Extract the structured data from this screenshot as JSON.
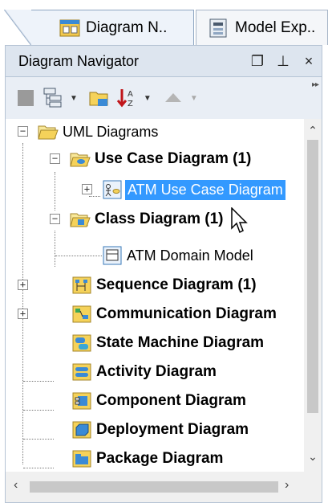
{
  "tabs": [
    {
      "label": "Diagram N..",
      "icon": "diagram-navigator-icon",
      "active": true
    },
    {
      "label": "Model Exp..",
      "icon": "model-explorer-icon",
      "active": false
    }
  ],
  "panel": {
    "title": "Diagram Navigator",
    "buttons": {
      "restore": "❐",
      "pin": "⊥",
      "close": "×"
    }
  },
  "toolbar": {
    "icons": [
      "new-diagram-icon",
      "tree-layout-icon",
      "folder-view-icon",
      "sort-icon",
      "navigate-up-icon"
    ]
  },
  "tree": {
    "root": {
      "label": "UML Diagrams",
      "expanded": true
    },
    "categories": [
      {
        "label": "Use Case Diagram (1)",
        "expanded": true,
        "children": [
          {
            "label": "ATM Use Case Diagram",
            "selected": true,
            "has_children": true
          }
        ]
      },
      {
        "label": "Class Diagram (1)",
        "expanded": true,
        "children": [
          {
            "label": "ATM Domain Model",
            "selected": false
          }
        ]
      },
      {
        "label": "Sequence Diagram (1)",
        "expanded": false
      },
      {
        "label": "Communication Diagram",
        "expanded": false
      },
      {
        "label": "State Machine Diagram"
      },
      {
        "label": "Activity Diagram"
      },
      {
        "label": "Component Diagram"
      },
      {
        "label": "Deployment Diagram"
      },
      {
        "label": "Package Diagram"
      }
    ]
  },
  "colors": {
    "selection": "#3399ff",
    "folder": "#f5d25a",
    "panel_header": "#dde5ef"
  }
}
